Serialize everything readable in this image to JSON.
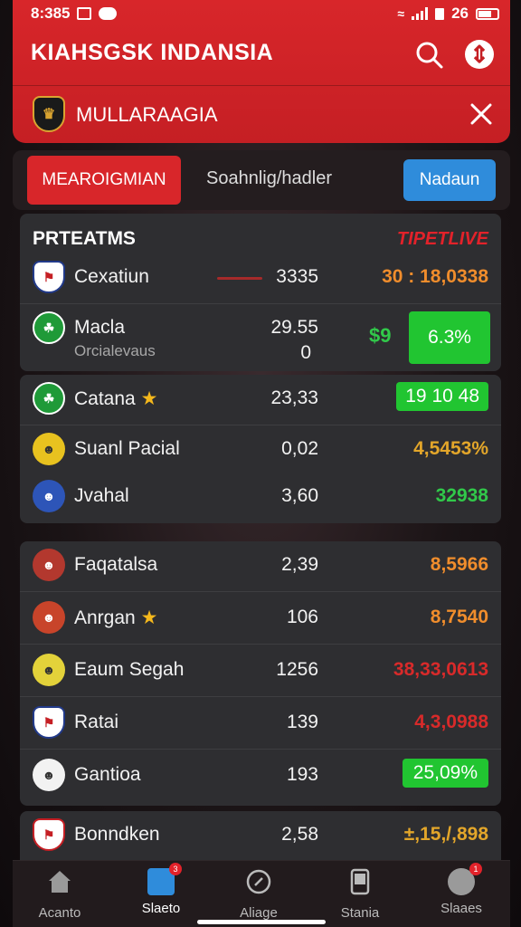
{
  "status_bar": {
    "time": "8:385",
    "battery": "26"
  },
  "header": {
    "title": "KIAHSGSK INDANSIA",
    "league_name": "MULLARAAGIA",
    "league_logo_icon": "shield-icon"
  },
  "tabs": {
    "active_label": "MEAROIGMIAN",
    "search_placeholder": "Soahnlig/hadler",
    "button_label": "Nadaun"
  },
  "section1": {
    "title": "PRTEATMS",
    "live_label": "TIPETLIVE",
    "rows": [
      {
        "name": "Cexatiun",
        "value": "3335",
        "pct": "30 : 18,0338"
      },
      {
        "name": "Macla",
        "sub": "Orcialevaus",
        "value": "29.55",
        "value2": "0",
        "extra": "$9",
        "pct": "6.3%"
      },
      {
        "name": "Catana",
        "value": "23,33",
        "pct": "19 10 48"
      },
      {
        "name": "Suanl Pacial",
        "value": "0,02",
        "pct": "4,5453%"
      },
      {
        "name": "Jvahal",
        "value": "3,60",
        "pct": "32938"
      }
    ]
  },
  "section2": {
    "rows": [
      {
        "name": "Faqatalsa",
        "value": "2,39",
        "pct": "8,5966"
      },
      {
        "name": "Anrgan",
        "value": "106",
        "pct": "8,7540"
      },
      {
        "name": "Eaum Segah",
        "value": "1256",
        "pct": "38,33,0613"
      },
      {
        "name": "Ratai",
        "value": "139",
        "pct": "4,3,0988"
      },
      {
        "name": "Gantioa",
        "value": "193",
        "pct": "25,09%"
      }
    ]
  },
  "section3": {
    "rows": [
      {
        "name": "Bonndken",
        "value": "2,58",
        "pct": "±,15,/,898"
      }
    ]
  },
  "nav": {
    "items": [
      {
        "label": "Acanto",
        "icon": "home-icon"
      },
      {
        "label": "Slaeto",
        "icon": "stats-icon",
        "badge": "3"
      },
      {
        "label": "Aliage",
        "icon": "compass-icon"
      },
      {
        "label": "Stania",
        "icon": "tablet-icon"
      },
      {
        "label": "Slaaes",
        "icon": "profile-icon",
        "badge": "1"
      }
    ]
  },
  "colors": {
    "brand_red": "#d8262a",
    "accent_blue": "#2f8cdb",
    "positive_green": "#21c531",
    "card_bg": "#2e2e31"
  }
}
